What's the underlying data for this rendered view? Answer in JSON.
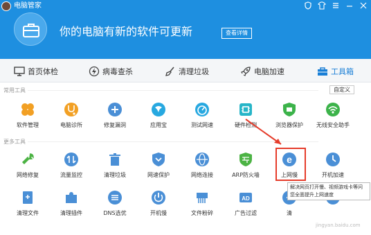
{
  "app": {
    "title": "电脑管家",
    "window_icons": [
      "shield-icon",
      "tshirt-icon",
      "menu-icon",
      "minimize-icon",
      "close-icon"
    ]
  },
  "header": {
    "headline": "你的电脑有新的软件可更新",
    "details_button": "查看详情",
    "background_color": "#1e8fe0"
  },
  "nav": {
    "items": [
      {
        "label": "首页体检",
        "icon": "monitor-icon"
      },
      {
        "label": "病毒查杀",
        "icon": "lightning-icon"
      },
      {
        "label": "清理垃圾",
        "icon": "broom-icon"
      },
      {
        "label": "电脑加速",
        "icon": "rocket-icon"
      },
      {
        "label": "工具箱",
        "icon": "toolbox-icon",
        "active": true
      }
    ]
  },
  "sections": {
    "common_title": "常用工具",
    "more_title": "更多工具",
    "custom_button": "自定义"
  },
  "common_tools": [
    {
      "label": "软件管理",
      "icon": "software-manager-icon",
      "color": "#f2a024"
    },
    {
      "label": "电脑诊所",
      "icon": "stethoscope-icon",
      "color": "#f2a024"
    },
    {
      "label": "修复漏洞",
      "icon": "patch-icon",
      "color": "#4a8fd6"
    },
    {
      "label": "应用宝",
      "icon": "appstore-icon",
      "color": "#27a8e0"
    },
    {
      "label": "测试网速",
      "icon": "speedometer-icon",
      "color": "#27a8e0"
    },
    {
      "label": "硬件检测",
      "icon": "chip-icon",
      "color": "#27b5c8"
    },
    {
      "label": "浏览器保护",
      "icon": "browser-shield-icon",
      "color": "#3cb34a"
    },
    {
      "label": "无线安全助手",
      "icon": "wifi-icon",
      "color": "#3cb34a"
    }
  ],
  "more_tools_row1": [
    {
      "label": "网络修复",
      "icon": "wrench-icon",
      "color": "#4cb344"
    },
    {
      "label": "流量监控",
      "icon": "traffic-icon",
      "color": "#4a8fd6"
    },
    {
      "label": "清理垃圾",
      "icon": "trash-icon",
      "color": "#4a8fd6"
    },
    {
      "label": "网速保护",
      "icon": "shield-chevron-icon",
      "color": "#4a8fd6"
    },
    {
      "label": "网络连接",
      "icon": "globe-icon",
      "color": "#4a8fd6"
    },
    {
      "label": "ARP防火墙",
      "icon": "arp-firewall-icon",
      "color": "#4cb344"
    },
    {
      "label": "上网慢",
      "icon": "ie-slow-icon",
      "color": "#4a8fd6"
    },
    {
      "label": "开机加速",
      "icon": "boot-speed-icon",
      "color": "#4a8fd6"
    }
  ],
  "more_tools_row2": [
    {
      "label": "清理文件",
      "icon": "file-clean-icon",
      "color": "#4a8fd6"
    },
    {
      "label": "清理插件",
      "icon": "puzzle-icon",
      "color": "#4a8fd6"
    },
    {
      "label": "DNS选优",
      "icon": "dns-icon",
      "color": "#4a8fd6"
    },
    {
      "label": "开机慢",
      "icon": "power-slow-icon",
      "color": "#4a8fd6"
    },
    {
      "label": "文件粉碎",
      "icon": "shredder-icon",
      "color": "#4a8fd6"
    },
    {
      "label": "广告过滤",
      "icon": "ad-filter-icon",
      "color": "#4a8fd6"
    },
    {
      "label": "清",
      "icon": "partial-icon",
      "color": "#4a8fd6"
    },
    {
      "label": "",
      "icon": "partial-icon-2",
      "color": "#4a8fd6"
    }
  ],
  "tooltip": {
    "line1": "解决网页打开慢、视频游戏卡等问",
    "line2": "您全面提升上网速度"
  },
  "watermark": "jingyan.baidu.com",
  "annotation_color": "#e53b2a"
}
